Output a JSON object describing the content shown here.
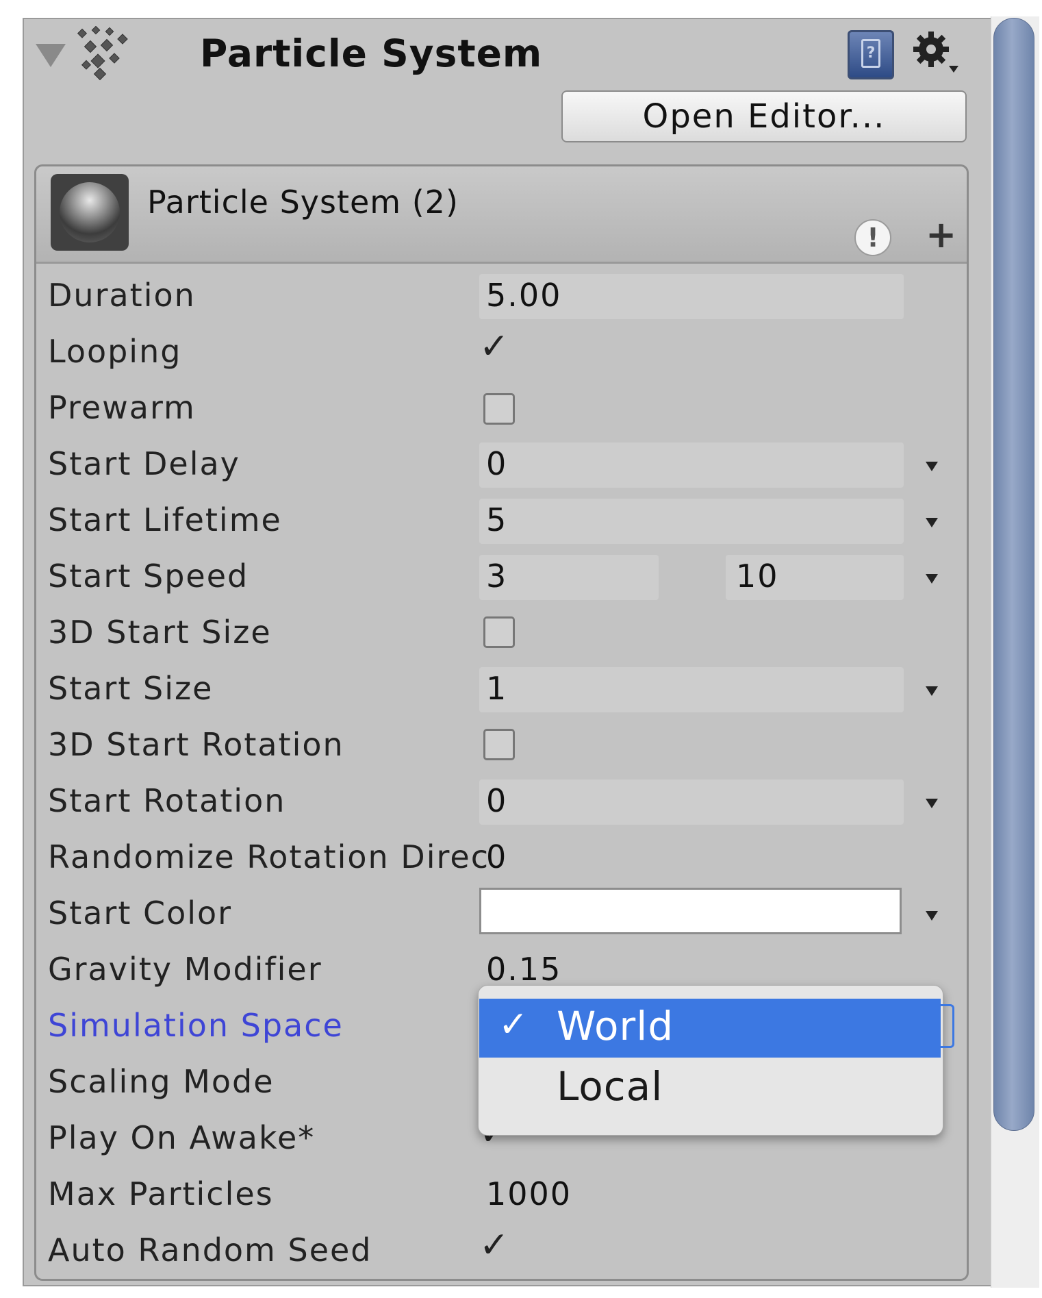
{
  "component": {
    "title": "Particle System",
    "open_editor_label": "Open Editor...",
    "icons": [
      "foldout-arrow-icon",
      "particle-system-icon",
      "help-book-icon",
      "gear-icon"
    ]
  },
  "module": {
    "title": "Particle System (2)",
    "icons": [
      "sphere-preview-icon",
      "warning-icon",
      "plus-icon"
    ],
    "plus_symbol": "+",
    "warning_symbol": "!"
  },
  "rows": {
    "duration": {
      "label": "Duration",
      "value": "5.00"
    },
    "looping": {
      "label": "Looping",
      "checked": true
    },
    "prewarm": {
      "label": "Prewarm",
      "checked": false
    },
    "start_delay": {
      "label": "Start Delay",
      "value": "0"
    },
    "start_lifetime": {
      "label": "Start Lifetime",
      "value": "5"
    },
    "start_speed": {
      "label": "Start Speed",
      "min": "3",
      "max": "10"
    },
    "start_size_3d": {
      "label": "3D Start Size",
      "checked": false
    },
    "start_size": {
      "label": "Start Size",
      "value": "1"
    },
    "start_rotation_3d": {
      "label": "3D Start Rotation",
      "checked": false
    },
    "start_rotation": {
      "label": "Start Rotation",
      "value": "0"
    },
    "randomize_rotation": {
      "label": "Randomize Rotation Direc",
      "value": "0"
    },
    "start_color": {
      "label": "Start Color",
      "color": "#ffffff"
    },
    "gravity_modifier": {
      "label": "Gravity Modifier",
      "value": "0.15"
    },
    "simulation_space": {
      "label": "Simulation Space",
      "selected": "World"
    },
    "scaling_mode": {
      "label": "Scaling Mode"
    },
    "play_on_awake": {
      "label": "Play On Awake*",
      "checked": true
    },
    "max_particles": {
      "label": "Max Particles",
      "value": "1000"
    },
    "auto_random_seed": {
      "label": "Auto Random Seed",
      "checked": true
    }
  },
  "dropdown": {
    "options": [
      "World",
      "Local"
    ],
    "selected": "World",
    "check_symbol": "✓"
  },
  "checkmark_symbol": "✓",
  "colors": {
    "panel": "#c4c4c4",
    "highlight_label": "#3e45d6",
    "selection": "#3c78e2",
    "scrollbar": "#7b90b5"
  }
}
